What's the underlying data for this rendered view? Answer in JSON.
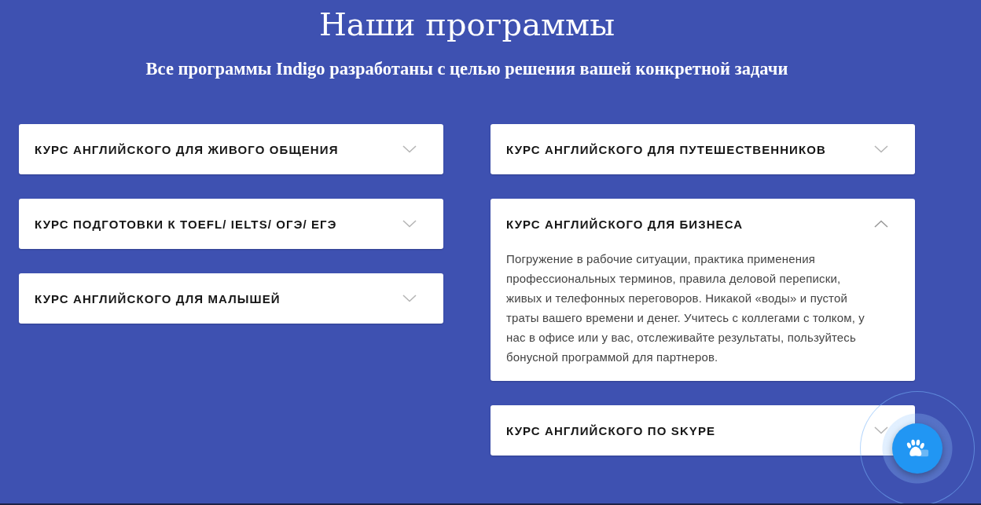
{
  "header": {
    "title": "Наши программы",
    "subtitle": "Все программы Indigo разработаны с целью решения вашей конкретной задачи"
  },
  "columns": [
    {
      "courses": [
        {
          "title": "КУРС АНГЛИЙСКОГО ДЛЯ ЖИВОГО ОБЩЕНИЯ",
          "expanded": false
        },
        {
          "title": "КУРС ПОДГОТОВКИ К TOEFL/ IELTS/ ОГЭ/ ЕГЭ",
          "expanded": false
        },
        {
          "title": "КУРС АНГЛИЙСКОГО ДЛЯ МАЛЫШЕЙ",
          "expanded": false
        }
      ]
    },
    {
      "courses": [
        {
          "title": "КУРС АНГЛИЙСКОГО ДЛЯ ПУТЕШЕСТВЕННИКОВ",
          "expanded": false
        },
        {
          "title": "КУРС АНГЛИЙСКОГО ДЛЯ БИЗНЕСА",
          "expanded": true,
          "description": "Погружение в рабочие ситуации, практика применения профессиональных терминов, правила деловой переписки, живых и телефонных переговоров. Никакой «воды» и пустой траты вашего времени и денег. Учитесь с коллегами с толком, у нас в офисе или у вас, отслеживайте результаты, пользуйтесь бонусной программой для партнеров."
        },
        {
          "title": "КУРС АНГЛИЙСКОГО ПО SKYPE",
          "expanded": false
        }
      ]
    }
  ]
}
